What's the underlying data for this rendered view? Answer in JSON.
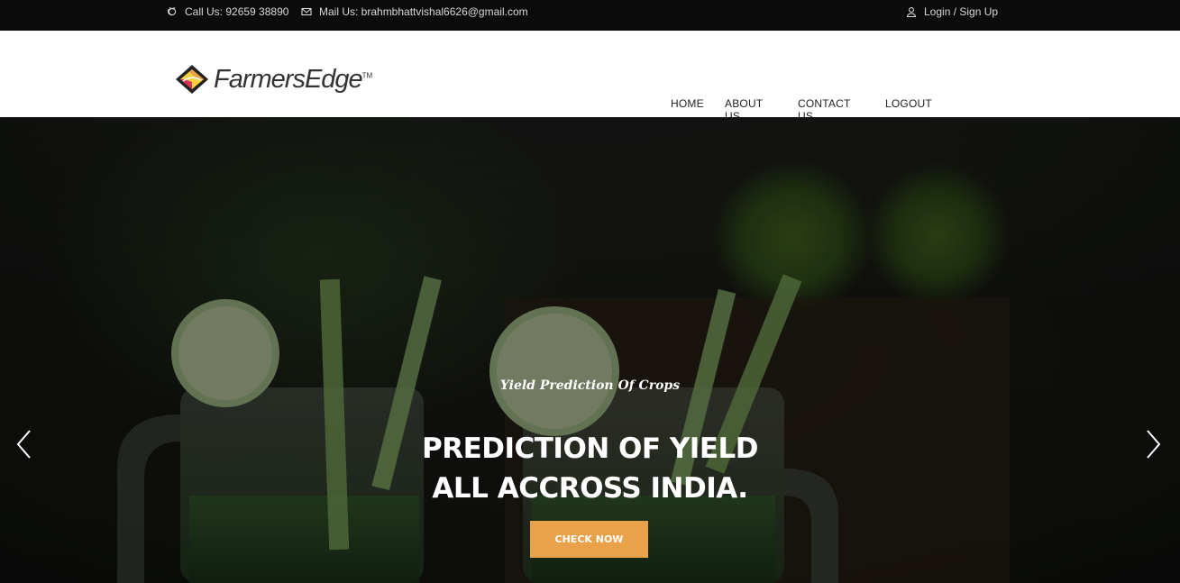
{
  "topbar": {
    "call_label": "Call Us: 92659 38890",
    "mail_label": "Mail Us: brahmbhattvishal6626@gmail.com",
    "login_label": "Login / Sign Up"
  },
  "header": {
    "logo_text": "FarmersEdge",
    "logo_tm": "TM"
  },
  "nav": {
    "items": [
      {
        "label": "HOME"
      },
      {
        "label": "ABOUT US"
      },
      {
        "label": "CONTACT US"
      },
      {
        "label": "LOGOUT"
      }
    ]
  },
  "hero": {
    "subtitle": "Yield Prediction Of Crops",
    "headline_line1": "PREDICTION OF YIELD",
    "headline_line2": "ALL ACCROSS INDIA.",
    "cta_label": "CHECK NOW"
  },
  "colors": {
    "topbar_bg": "#0b0b0b",
    "accent": "#e9a24a",
    "header_bg": "#ffffff"
  },
  "icons": [
    "phone-icon",
    "mail-icon",
    "user-icon",
    "chevron-left-icon",
    "chevron-right-icon"
  ]
}
